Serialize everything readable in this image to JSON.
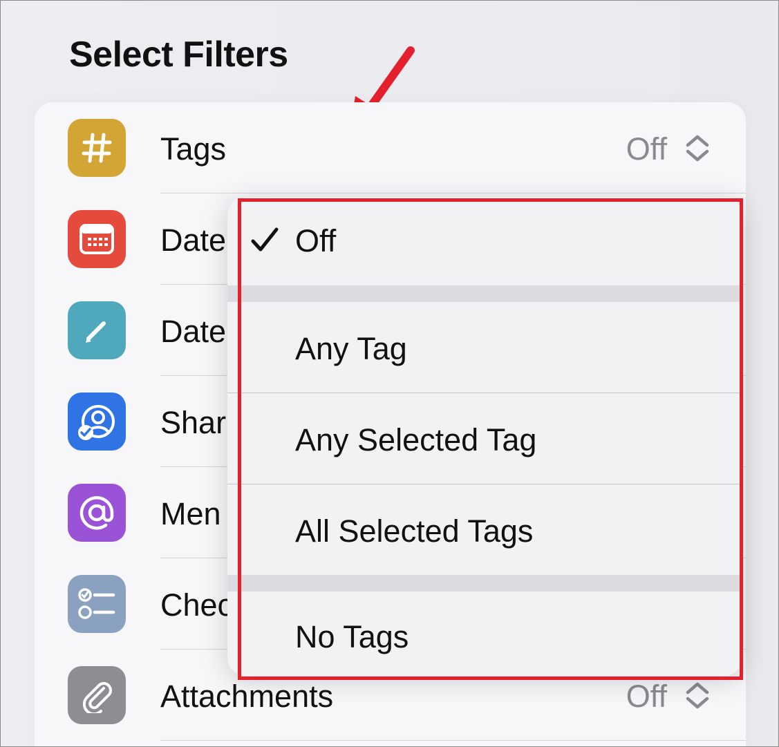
{
  "page": {
    "title": "Select Filters"
  },
  "filters": [
    {
      "label": "Tags",
      "value": "Off",
      "icon": "hashtag-icon",
      "color": "#d3a534"
    },
    {
      "label": "Date",
      "value": "",
      "icon": "calendar-icon",
      "color": "#e54b3c"
    },
    {
      "label": "Date",
      "value": "",
      "icon": "pencil-icon",
      "color": "#4fa8bc"
    },
    {
      "label": "Shar",
      "value": "",
      "icon": "shared-person-icon",
      "color": "#2f73e5"
    },
    {
      "label": "Men",
      "value": "",
      "icon": "at-sign-icon",
      "color": "#9a52d6"
    },
    {
      "label": "Chec",
      "value": "",
      "icon": "checklist-icon",
      "color": "#8aa2bf"
    },
    {
      "label": "Attachments",
      "value": "Off",
      "icon": "paperclip-icon",
      "color": "#8d8d92"
    }
  ],
  "menu": {
    "selected": "Off",
    "options": [
      "Off",
      "Any Tag",
      "Any Selected Tag",
      "All Selected Tags",
      "No Tags"
    ]
  },
  "annotation": {
    "color": "#e3202b"
  }
}
